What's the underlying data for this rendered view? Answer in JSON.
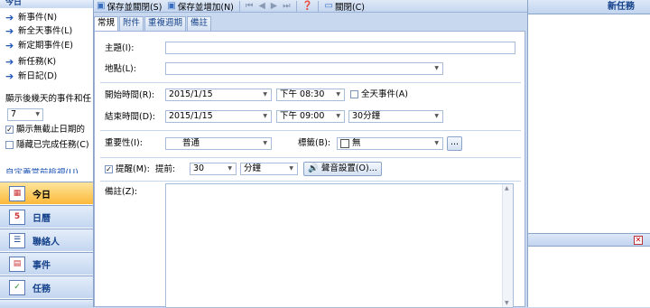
{
  "left": {
    "header": "今日",
    "links": [
      "新事件(N)",
      "新全天事件(L)",
      "新定期事件(E)",
      "新任務(K)",
      "新日記(D)"
    ],
    "show_days_label": "顯示後幾天的事件和任",
    "days_value": "7",
    "check_no_due": "顯示無截止日期的",
    "check_hide_done": "隱藏已完成任務(C)",
    "customize_link": "自定義當前檢視(U)...",
    "nav": [
      {
        "label": "今日",
        "icon": "today-icon"
      },
      {
        "label": "日曆",
        "icon": "calendar-icon"
      },
      {
        "label": "聯絡人",
        "icon": "contacts-icon"
      },
      {
        "label": "事件",
        "icon": "events-icon"
      },
      {
        "label": "任務",
        "icon": "tasks-icon"
      }
    ]
  },
  "toolbar": {
    "save_close": "保存並關閉(S)",
    "save_add": "保存並增加(N)",
    "close": "關閉(C)"
  },
  "tabs": [
    "常規",
    "附件",
    "重複週期",
    "備註"
  ],
  "form": {
    "subject_label": "主題(I):",
    "subject_value": "",
    "location_label": "地點(L):",
    "location_value": "",
    "start_label": "開始時間(R):",
    "start_date": "2015/1/15",
    "start_time": "下午 08:30",
    "allday_label": "全天事件(A)",
    "end_label": "結束時間(D):",
    "end_date": "2015/1/15",
    "end_time": "下午 09:00",
    "duration": "30分鐘",
    "importance_label": "重要性(I):",
    "importance_value": "普通",
    "tag_label": "標籤(B):",
    "tag_value": "無",
    "reminder_label": "提醒(M):",
    "before_label": "提前:",
    "reminder_amount": "30",
    "reminder_unit": "分鐘",
    "sound_button": "聲音設置(O)...",
    "notes_label": "備註(Z):",
    "browse_button": "..."
  },
  "right": {
    "title": "新任務"
  }
}
